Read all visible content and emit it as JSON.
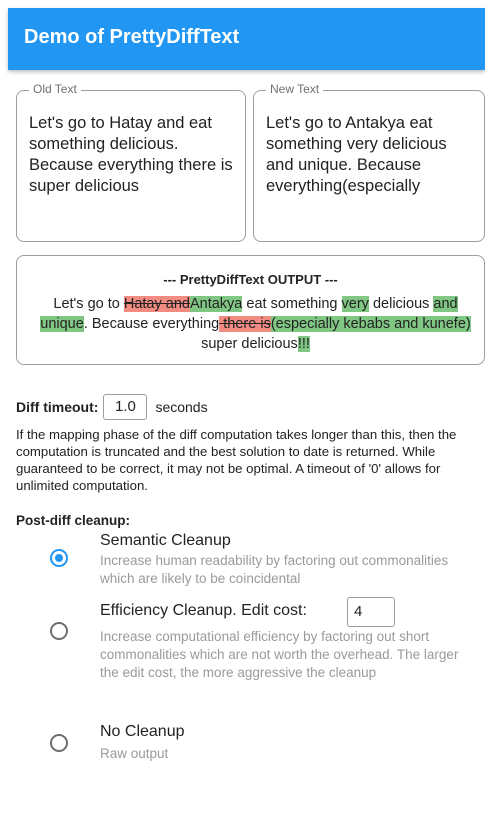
{
  "appbar": {
    "title": "Demo of PrettyDiffText"
  },
  "old_text": {
    "label": "Old Text",
    "value": "Let's go to Hatay and eat something delicious. Because everything there is super delicious"
  },
  "new_text": {
    "label": "New Text",
    "value": "Let's go to Antakya eat something very delicious and unique. Because everything(especially"
  },
  "output": {
    "title": "--- PrettyDiffText OUTPUT ---",
    "segments": [
      {
        "type": "equal",
        "text": "Let's go to "
      },
      {
        "type": "delete",
        "text": "Hatay and"
      },
      {
        "type": "insert",
        "text": "Antakya"
      },
      {
        "type": "equal",
        "text": " eat something "
      },
      {
        "type": "insert",
        "text": "very"
      },
      {
        "type": "equal",
        "text": " delicious "
      },
      {
        "type": "insert",
        "text": "and unique"
      },
      {
        "type": "equal",
        "text": ". Because everything"
      },
      {
        "type": "delete",
        "text": " there is"
      },
      {
        "type": "insert",
        "text": "(especially kebabs and kunefe)"
      },
      {
        "type": "equal",
        "text": " super delicious"
      },
      {
        "type": "insert",
        "text": "!!!"
      }
    ]
  },
  "diff_timeout": {
    "label": "Diff timeout:",
    "value": "1.0",
    "unit": "seconds",
    "help": "If the mapping phase of the diff computation takes longer than this, then the computation is truncated and the best solution to date is returned. While guaranteed to be correct, it may not be optimal. A timeout of '0' allows for unlimited computation."
  },
  "cleanup": {
    "heading": "Post-diff cleanup:",
    "options": [
      {
        "title": "Semantic Cleanup",
        "subtitle": "Increase human readability by factoring out commonalities which are likely to be coincidental",
        "selected": true
      },
      {
        "title": "Efficiency Cleanup. Edit cost:",
        "subtitle": "Increase computational efficiency by factoring out short commonalities which are not worth the overhead. The larger the edit cost, the more aggressive the cleanup",
        "selected": false,
        "edit_cost": "4"
      },
      {
        "title": "No Cleanup",
        "subtitle": "Raw output",
        "selected": false
      }
    ]
  },
  "colors": {
    "primary": "#2196F3",
    "deleted_bg": "#f28b82",
    "inserted_bg": "#81c784"
  }
}
